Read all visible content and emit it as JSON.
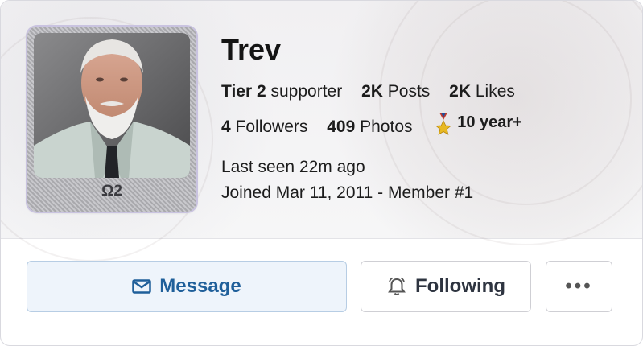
{
  "profile": {
    "name": "Trev",
    "rank": "Ω2",
    "tier_value": "Tier 2",
    "tier_label": "supporter",
    "posts_value": "2K",
    "posts_label": "Posts",
    "likes_value": "2K",
    "likes_label": "Likes",
    "followers_value": "4",
    "followers_label": "Followers",
    "photos_value": "409",
    "photos_label": "Photos",
    "badge": "10 year+",
    "last_seen": "Last seen 22m ago",
    "joined": "Joined Mar 11, 2011 - Member #1"
  },
  "actions": {
    "message": "Message",
    "following": "Following",
    "more": "•••"
  },
  "colors": {
    "message_text": "#1f5f9a",
    "message_bg": "#eef4fb",
    "following_text": "#2e3440"
  },
  "icons": {
    "message": "envelope-icon",
    "following": "bell-icon",
    "badge": "medal-icon"
  }
}
